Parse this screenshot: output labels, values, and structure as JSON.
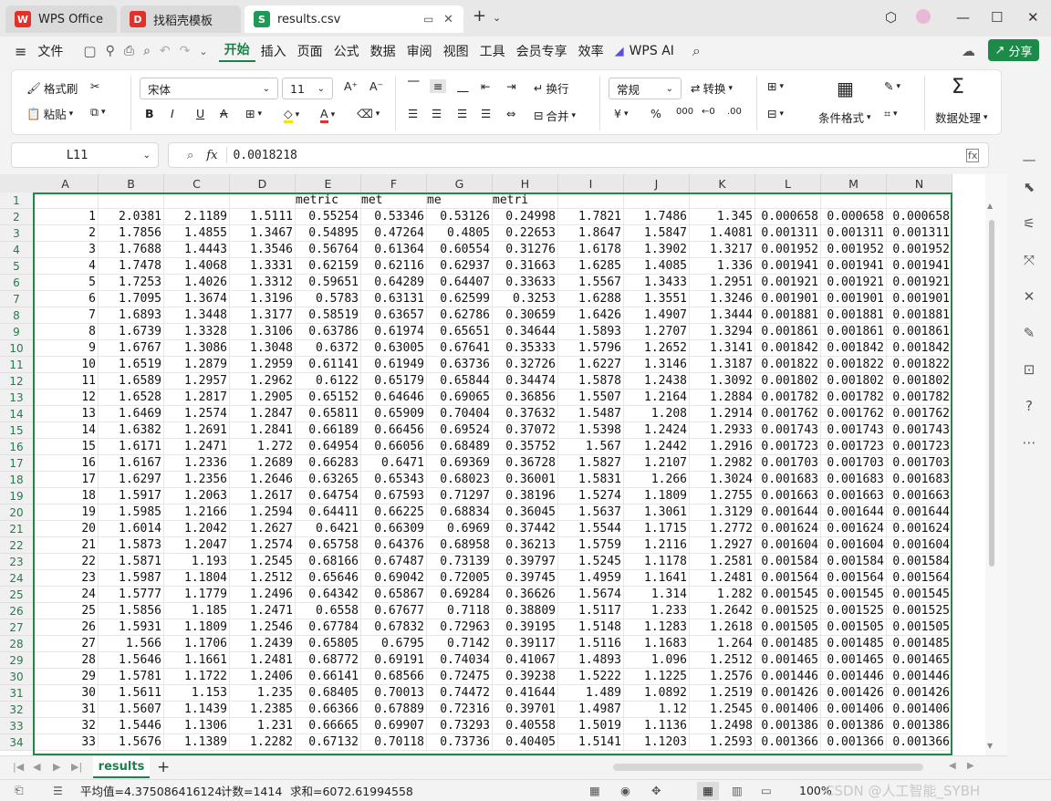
{
  "tabs": [
    {
      "label": "WPS Office",
      "icon": "wps-logo-icon"
    },
    {
      "label": "找稻壳模板",
      "icon": "docer-icon"
    },
    {
      "label": "results.csv",
      "icon": "spreadsheet-icon"
    }
  ],
  "menu": {
    "file": "文件",
    "items": [
      "开始",
      "插入",
      "页面",
      "公式",
      "数据",
      "审阅",
      "视图",
      "工具",
      "会员专享",
      "效率",
      "WPS AI"
    ],
    "active": "开始",
    "share": "分享"
  },
  "ribbon": {
    "format_painter": "格式刷",
    "paste": "粘贴",
    "font_name": "宋体",
    "font_size": "11",
    "wrap": "换行",
    "merge": "合并",
    "number_format": "常规",
    "convert": "转换",
    "conditional_format": "条件格式",
    "data_process": "数据处理"
  },
  "formula_bar": {
    "name_box": "L11",
    "fx": "fx",
    "value": "0.0018218"
  },
  "columns": [
    "A",
    "B",
    "C",
    "D",
    "E",
    "F",
    "G",
    "H",
    "I",
    "J",
    "K",
    "L",
    "M",
    "N"
  ],
  "row1": {
    "E": "metric",
    "F": "met",
    "G": "me",
    "H": "metri"
  },
  "rows": [
    [
      "1",
      "2.0381",
      "2.1189",
      "1.5111",
      "0.55254",
      "0.53346",
      "0.53126",
      "0.24998",
      "1.7821",
      "1.7486",
      "1.345",
      "0.000658",
      "0.000658",
      "0.000658"
    ],
    [
      "2",
      "1.7856",
      "1.4855",
      "1.3467",
      "0.54895",
      "0.47264",
      "0.4805",
      "0.22653",
      "1.8647",
      "1.5847",
      "1.4081",
      "0.001311",
      "0.001311",
      "0.001311"
    ],
    [
      "3",
      "1.7688",
      "1.4443",
      "1.3546",
      "0.56764",
      "0.61364",
      "0.60554",
      "0.31276",
      "1.6178",
      "1.3902",
      "1.3217",
      "0.001952",
      "0.001952",
      "0.001952"
    ],
    [
      "4",
      "1.7478",
      "1.4068",
      "1.3331",
      "0.62159",
      "0.62116",
      "0.62937",
      "0.31663",
      "1.6285",
      "1.4085",
      "1.336",
      "0.001941",
      "0.001941",
      "0.001941"
    ],
    [
      "5",
      "1.7253",
      "1.4026",
      "1.3312",
      "0.59651",
      "0.64289",
      "0.64407",
      "0.33633",
      "1.5567",
      "1.3433",
      "1.2951",
      "0.001921",
      "0.001921",
      "0.001921"
    ],
    [
      "6",
      "1.7095",
      "1.3674",
      "1.3196",
      "0.5783",
      "0.63131",
      "0.62599",
      "0.3253",
      "1.6288",
      "1.3551",
      "1.3246",
      "0.001901",
      "0.001901",
      "0.001901"
    ],
    [
      "7",
      "1.6893",
      "1.3448",
      "1.3177",
      "0.58519",
      "0.63657",
      "0.62786",
      "0.30659",
      "1.6426",
      "1.4907",
      "1.3444",
      "0.001881",
      "0.001881",
      "0.001881"
    ],
    [
      "8",
      "1.6739",
      "1.3328",
      "1.3106",
      "0.63786",
      "0.61974",
      "0.65651",
      "0.34644",
      "1.5893",
      "1.2707",
      "1.3294",
      "0.001861",
      "0.001861",
      "0.001861"
    ],
    [
      "9",
      "1.6767",
      "1.3086",
      "1.3048",
      "0.6372",
      "0.63005",
      "0.67641",
      "0.35333",
      "1.5796",
      "1.2652",
      "1.3141",
      "0.001842",
      "0.001842",
      "0.001842"
    ],
    [
      "10",
      "1.6519",
      "1.2879",
      "1.2959",
      "0.61141",
      "0.61949",
      "0.63736",
      "0.32726",
      "1.6227",
      "1.3146",
      "1.3187",
      "0.001822",
      "0.001822",
      "0.001822"
    ],
    [
      "11",
      "1.6589",
      "1.2957",
      "1.2962",
      "0.6122",
      "0.65179",
      "0.65844",
      "0.34474",
      "1.5878",
      "1.2438",
      "1.3092",
      "0.001802",
      "0.001802",
      "0.001802"
    ],
    [
      "12",
      "1.6528",
      "1.2817",
      "1.2905",
      "0.65152",
      "0.64646",
      "0.69065",
      "0.36856",
      "1.5507",
      "1.2164",
      "1.2884",
      "0.001782",
      "0.001782",
      "0.001782"
    ],
    [
      "13",
      "1.6469",
      "1.2574",
      "1.2847",
      "0.65811",
      "0.65909",
      "0.70404",
      "0.37632",
      "1.5487",
      "1.208",
      "1.2914",
      "0.001762",
      "0.001762",
      "0.001762"
    ],
    [
      "14",
      "1.6382",
      "1.2691",
      "1.2841",
      "0.66189",
      "0.66456",
      "0.69524",
      "0.37072",
      "1.5398",
      "1.2424",
      "1.2933",
      "0.001743",
      "0.001743",
      "0.001743"
    ],
    [
      "15",
      "1.6171",
      "1.2471",
      "1.272",
      "0.64954",
      "0.66056",
      "0.68489",
      "0.35752",
      "1.567",
      "1.2442",
      "1.2916",
      "0.001723",
      "0.001723",
      "0.001723"
    ],
    [
      "16",
      "1.6167",
      "1.2336",
      "1.2689",
      "0.66283",
      "0.6471",
      "0.69369",
      "0.36728",
      "1.5827",
      "1.2107",
      "1.2982",
      "0.001703",
      "0.001703",
      "0.001703"
    ],
    [
      "17",
      "1.6297",
      "1.2356",
      "1.2646",
      "0.63265",
      "0.65343",
      "0.68023",
      "0.36001",
      "1.5831",
      "1.266",
      "1.3024",
      "0.001683",
      "0.001683",
      "0.001683"
    ],
    [
      "18",
      "1.5917",
      "1.2063",
      "1.2617",
      "0.64754",
      "0.67593",
      "0.71297",
      "0.38196",
      "1.5274",
      "1.1809",
      "1.2755",
      "0.001663",
      "0.001663",
      "0.001663"
    ],
    [
      "19",
      "1.5985",
      "1.2166",
      "1.2594",
      "0.64411",
      "0.66225",
      "0.68834",
      "0.36045",
      "1.5637",
      "1.3061",
      "1.3129",
      "0.001644",
      "0.001644",
      "0.001644"
    ],
    [
      "20",
      "1.6014",
      "1.2042",
      "1.2627",
      "0.6421",
      "0.66309",
      "0.6969",
      "0.37442",
      "1.5544",
      "1.1715",
      "1.2772",
      "0.001624",
      "0.001624",
      "0.001624"
    ],
    [
      "21",
      "1.5873",
      "1.2047",
      "1.2574",
      "0.65758",
      "0.64376",
      "0.68958",
      "0.36213",
      "1.5759",
      "1.2116",
      "1.2927",
      "0.001604",
      "0.001604",
      "0.001604"
    ],
    [
      "22",
      "1.5871",
      "1.193",
      "1.2545",
      "0.68166",
      "0.67487",
      "0.73139",
      "0.39797",
      "1.5245",
      "1.1178",
      "1.2581",
      "0.001584",
      "0.001584",
      "0.001584"
    ],
    [
      "23",
      "1.5987",
      "1.1804",
      "1.2512",
      "0.65646",
      "0.69042",
      "0.72005",
      "0.39745",
      "1.4959",
      "1.1641",
      "1.2481",
      "0.001564",
      "0.001564",
      "0.001564"
    ],
    [
      "24",
      "1.5777",
      "1.1779",
      "1.2496",
      "0.64342",
      "0.65867",
      "0.69284",
      "0.36626",
      "1.5674",
      "1.314",
      "1.282",
      "0.001545",
      "0.001545",
      "0.001545"
    ],
    [
      "25",
      "1.5856",
      "1.185",
      "1.2471",
      "0.6558",
      "0.67677",
      "0.7118",
      "0.38809",
      "1.5117",
      "1.233",
      "1.2642",
      "0.001525",
      "0.001525",
      "0.001525"
    ],
    [
      "26",
      "1.5931",
      "1.1809",
      "1.2546",
      "0.67784",
      "0.67832",
      "0.72963",
      "0.39195",
      "1.5148",
      "1.1283",
      "1.2618",
      "0.001505",
      "0.001505",
      "0.001505"
    ],
    [
      "27",
      "1.566",
      "1.1706",
      "1.2439",
      "0.65805",
      "0.6795",
      "0.7142",
      "0.39117",
      "1.5116",
      "1.1683",
      "1.264",
      "0.001485",
      "0.001485",
      "0.001485"
    ],
    [
      "28",
      "1.5646",
      "1.1661",
      "1.2481",
      "0.68772",
      "0.69191",
      "0.74034",
      "0.41067",
      "1.4893",
      "1.096",
      "1.2512",
      "0.001465",
      "0.001465",
      "0.001465"
    ],
    [
      "29",
      "1.5781",
      "1.1722",
      "1.2406",
      "0.66141",
      "0.68566",
      "0.72475",
      "0.39238",
      "1.5222",
      "1.1225",
      "1.2576",
      "0.001446",
      "0.001446",
      "0.001446"
    ],
    [
      "30",
      "1.5611",
      "1.153",
      "1.235",
      "0.68405",
      "0.70013",
      "0.74472",
      "0.41644",
      "1.489",
      "1.0892",
      "1.2519",
      "0.001426",
      "0.001426",
      "0.001426"
    ],
    [
      "31",
      "1.5607",
      "1.1439",
      "1.2385",
      "0.66366",
      "0.67889",
      "0.72316",
      "0.39701",
      "1.4987",
      "1.12",
      "1.2545",
      "0.001406",
      "0.001406",
      "0.001406"
    ],
    [
      "32",
      "1.5446",
      "1.1306",
      "1.231",
      "0.66665",
      "0.69907",
      "0.73293",
      "0.40558",
      "1.5019",
      "1.1136",
      "1.2498",
      "0.001386",
      "0.001386",
      "0.001386"
    ],
    [
      "33",
      "1.5676",
      "1.1389",
      "1.2282",
      "0.67132",
      "0.70118",
      "0.73736",
      "0.40405",
      "1.5141",
      "1.1203",
      "1.2593",
      "0.001366",
      "0.001366",
      "0.001366"
    ]
  ],
  "sheet_tab": "results",
  "status": {
    "average": "平均值=4.375086416124",
    "count": "计数=1414",
    "sum": "求和=6072.61994558",
    "zoom": "100%",
    "watermark": "CSDN @人工智能_SYBH"
  },
  "colors": {
    "accent": "#1e7f4a",
    "wps_red": "#e0312b"
  }
}
